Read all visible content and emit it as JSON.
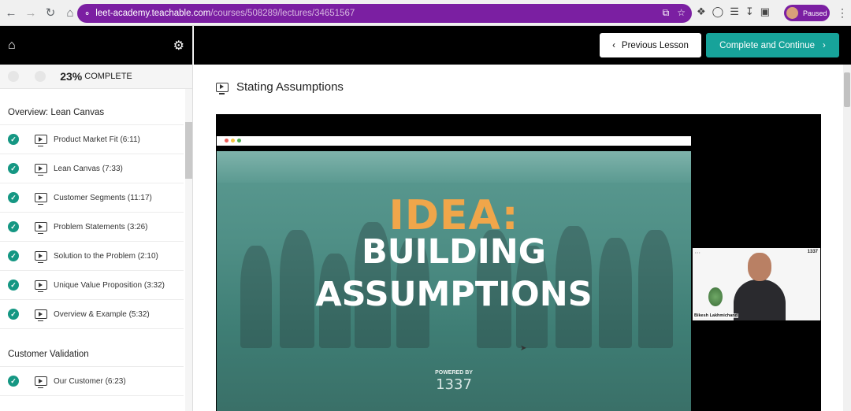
{
  "browser": {
    "url_host": "leet-academy.teachable.com",
    "url_path": "/courses/508289/lectures/34651567",
    "profile_label": "Paused"
  },
  "sidebar": {
    "progress_percent": "23%",
    "progress_label": "COMPLETE",
    "sections": [
      {
        "title": "Overview: Lean Canvas",
        "lessons": [
          {
            "title": "Product Market Fit (6:11)",
            "complete": true
          },
          {
            "title": "Lean Canvas (7:33)",
            "complete": true
          },
          {
            "title": "Customer Segments (11:17)",
            "complete": true
          },
          {
            "title": "Problem Statements (3:26)",
            "complete": true
          },
          {
            "title": "Solution to the Problem (2:10)",
            "complete": true
          },
          {
            "title": "Unique Value Proposition (3:32)",
            "complete": true
          },
          {
            "title": "Overview & Example (5:32)",
            "complete": true
          }
        ]
      },
      {
        "title": "Customer Validation",
        "lessons": [
          {
            "title": "Our Customer (6:23)",
            "complete": true
          }
        ]
      }
    ]
  },
  "topbar": {
    "prev_label": "Previous Lesson",
    "next_label": "Complete and Continue"
  },
  "lecture": {
    "title": "Stating Assumptions"
  },
  "video": {
    "slide_line1": "IDEA:",
    "slide_line2": "BUILDING",
    "slide_line3": "ASSUMPTIONS",
    "powered_by": "POWERED BY",
    "brand": "1337",
    "presenter_name": "Bikesh Lakhmichand",
    "cam_logo": "1337"
  },
  "colors": {
    "accent": "#17a39a",
    "check": "#159783",
    "profile": "#7b1fa2"
  }
}
